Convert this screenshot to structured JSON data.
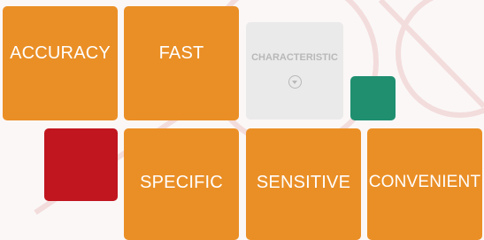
{
  "tiles": {
    "accuracy": "ACCURACY",
    "fast": "FAST",
    "characteristic": "CHARACTERISTIC",
    "specific": "SPECIFIC",
    "sensitive": "SENSITIVE",
    "convenient": "CONVENIENT"
  },
  "icons": {
    "expand": "chevron-down-circle-icon"
  },
  "colors": {
    "orange": "#ea8f26",
    "red": "#c1161f",
    "green": "#1f8f70",
    "ghost": "#e1e1e1"
  }
}
